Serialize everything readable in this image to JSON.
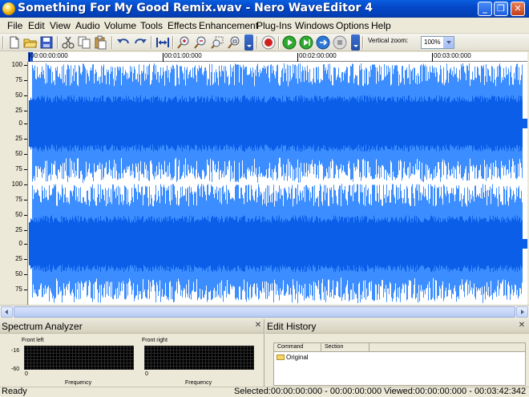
{
  "window": {
    "title": "Something For My Good Remix.wav - Nero WaveEditor 4",
    "min_glyph": "_",
    "max_glyph": "❐",
    "close_glyph": "✕"
  },
  "menu": {
    "items": [
      "File",
      "Edit",
      "View",
      "Audio",
      "Volume",
      "Tools",
      "Effects",
      "Enhancement",
      "Plug-Ins",
      "Windows",
      "Options",
      "Help"
    ]
  },
  "toolbar": {
    "icons": [
      "new-file-icon",
      "open-folder-icon",
      "save-icon",
      "cut-icon",
      "copy-icon",
      "paste-icon",
      "undo-icon",
      "redo-icon",
      "fit-icon",
      "zoom-in-icon",
      "zoom-out-icon",
      "zoom-selection-icon",
      "zoom-fit-icon",
      "record-icon",
      "play-icon",
      "play-selection-icon",
      "loop-icon",
      "stop-icon"
    ],
    "vertical_zoom_label": "Vertical zoom:",
    "vertical_zoom_value": "100%"
  },
  "ruler": {
    "labels": [
      "00:00:00:000",
      "00:01:00:000",
      "00:02:00:000",
      "00:03:00:000"
    ]
  },
  "scale": {
    "top_channel": [
      "100",
      "75",
      "50",
      "25",
      "0",
      "25",
      "50",
      "75"
    ],
    "bottom_channel": [
      "100",
      "75",
      "50",
      "25",
      "0",
      "25",
      "50",
      "75"
    ]
  },
  "colors": {
    "wave_light": "#3c8dff",
    "wave_dark": "#0b5ee8",
    "title_blue": "#0548c8"
  },
  "spectrum": {
    "title": "Spectrum Analyzer",
    "close_glyph": "✕",
    "left_label": "Front left",
    "right_label": "Front right",
    "db_top": "-16",
    "db_bottom": "-60",
    "zero": "0",
    "freq_label": "Frequency"
  },
  "history": {
    "title": "Edit History",
    "close_glyph": "✕",
    "col_command": "Command",
    "col_section": "Section",
    "rows": [
      "Original"
    ]
  },
  "status": {
    "ready": "Ready",
    "selected": "Selected:00:00:00:000 - 00:00:00:000",
    "viewed": "Viewed:00:00:00:000 - 00:03:42:342"
  }
}
